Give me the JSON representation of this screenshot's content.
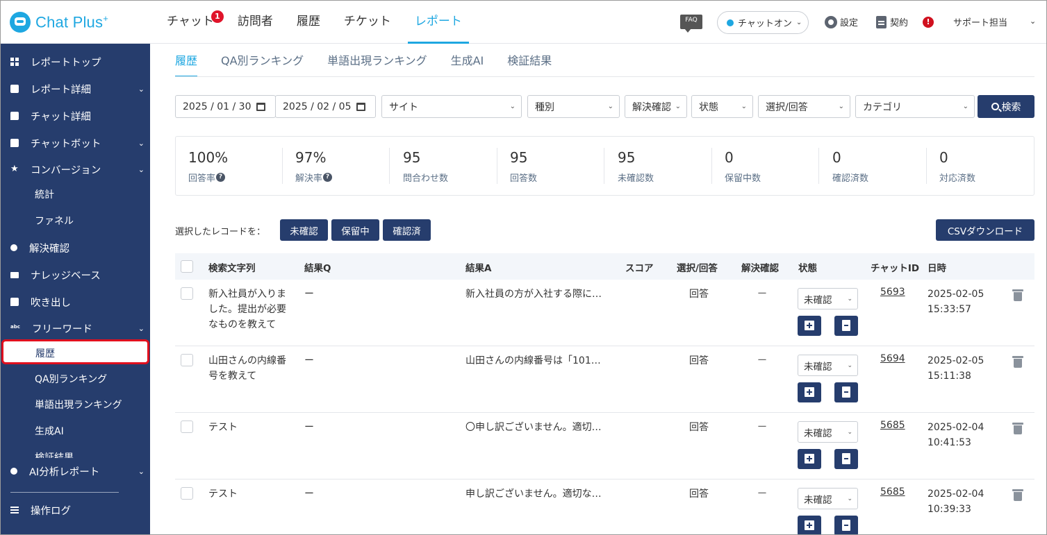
{
  "app": {
    "name": "Chat Plus",
    "name_sup": "+"
  },
  "topnav": {
    "items": [
      "チャット",
      "訪問者",
      "履歴",
      "チケット",
      "レポート"
    ],
    "chat_badge": "1",
    "active": "レポート"
  },
  "header": {
    "faq": "FAQ",
    "chat_status": "チャットオン",
    "settings": "設定",
    "contract": "契約",
    "alert": "!",
    "user": "サポート担当"
  },
  "sidebar": {
    "items": [
      {
        "label": "レポートトップ",
        "icon": "dashboard-icon"
      },
      {
        "label": "レポート詳細",
        "icon": "report-icon",
        "expandable": true
      },
      {
        "label": "チャット詳細",
        "icon": "chat-icon"
      },
      {
        "label": "チャットボット",
        "icon": "bot-icon",
        "expandable": true
      },
      {
        "label": "コンバージョン",
        "icon": "star-icon",
        "expandable": true
      },
      {
        "label": "統計",
        "sub": true
      },
      {
        "label": "ファネル",
        "sub": true
      },
      {
        "label": "解決確認",
        "icon": "bulb-icon"
      },
      {
        "label": "ナレッジベース",
        "icon": "book-icon"
      },
      {
        "label": "吹き出し",
        "icon": "bubble-icon"
      },
      {
        "label": "フリーワード",
        "icon": "abc-icon",
        "expandable": true
      },
      {
        "label": "履歴",
        "sub": true,
        "selected": true
      },
      {
        "label": "QA別ランキング",
        "sub": true
      },
      {
        "label": "単語出現ランキング",
        "sub": true
      },
      {
        "label": "生成AI",
        "sub": true
      },
      {
        "label": "検証結果",
        "sub": true
      },
      {
        "label": "AI分析レポート",
        "icon": "bulb-icon",
        "expandable": true
      },
      {
        "label": "操作ログ",
        "icon": "menu-icon"
      }
    ]
  },
  "tabs": [
    "履歴",
    "QA別ランキング",
    "単語出現ランキング",
    "生成AI",
    "検証結果"
  ],
  "filters": {
    "date_from": "2025 / 01 / 30",
    "date_to": "2025 / 02 / 05",
    "site": "サイト",
    "kind": "種別",
    "resolution": "解決確認",
    "state": "状態",
    "select_answer": "選択/回答",
    "category": "カテゴリ",
    "search": "検索"
  },
  "stats": [
    {
      "value": "100%",
      "label": "回答率",
      "help": true
    },
    {
      "value": "97%",
      "label": "解決率",
      "help": true
    },
    {
      "value": "95",
      "label": "問合わせ数"
    },
    {
      "value": "95",
      "label": "回答数"
    },
    {
      "value": "95",
      "label": "未確認数"
    },
    {
      "value": "0",
      "label": "保留中数"
    },
    {
      "value": "0",
      "label": "確認済数"
    },
    {
      "value": "0",
      "label": "対応済数"
    }
  ],
  "bulk": {
    "label": "選択したレコードを：",
    "unconfirmed": "未確認",
    "pending": "保留中",
    "confirmed": "確認済",
    "csv": "CSVダウンロード"
  },
  "table": {
    "headers": {
      "query": "検索文字列",
      "result_q": "結果Q",
      "result_a": "結果A",
      "score": "スコア",
      "select_answer": "選択/回答",
      "resolution": "解決確認",
      "state": "状態",
      "chat_id": "チャットID",
      "datetime": "日時"
    },
    "rows": [
      {
        "query": "新入社員が入りました。提出が必要なものを教えて",
        "result_q": "ー",
        "result_a": "新入社員の方が入社する際に…",
        "answer": "回答",
        "resolution": "ー",
        "state": "未確認",
        "chat_id": "5693",
        "date": "2025-02-05",
        "time": "15:33:57"
      },
      {
        "query": "山田さんの内線番号を教えて",
        "result_q": "ー",
        "result_a": "山田さんの内線番号は「101…",
        "answer": "回答",
        "resolution": "ー",
        "state": "未確認",
        "chat_id": "5694",
        "date": "2025-02-05",
        "time": "15:11:38"
      },
      {
        "query": "テスト",
        "result_q": "ー",
        "result_a": "〇申し訳ございません。適切…",
        "answer": "回答",
        "resolution": "ー",
        "state": "未確認",
        "chat_id": "5685",
        "date": "2025-02-04",
        "time": "10:41:53"
      },
      {
        "query": "テスト",
        "result_q": "ー",
        "result_a": "申し訳ございません。適切な…",
        "answer": "回答",
        "resolution": "ー",
        "state": "未確認",
        "chat_id": "5685",
        "date": "2025-02-04",
        "time": "10:39:33"
      }
    ]
  },
  "colors": {
    "accent": "#1ea7e1",
    "navy": "#263d6d",
    "highlight": "#e0101e"
  }
}
